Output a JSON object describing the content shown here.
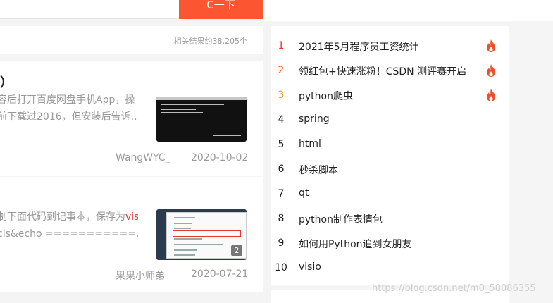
{
  "search": {
    "button_label": "C一下"
  },
  "results": {
    "count_text": "相关结果约38,205个",
    "items": [
      {
        "title": "）",
        "desc_line1": "容后打开百度网盘手机App，操",
        "desc_line2": "前下载过2016，但安装后告诉...",
        "author": "WangWYC_",
        "date": "2020-10-02"
      },
      {
        "desc_line1_pre": "制下面代码到记事本，保存为",
        "desc_line1_hl": "vis",
        "desc_line2": "cls&echo ===========...",
        "author": "果果小师弟",
        "date": "2020-07-21",
        "image_count": "2"
      }
    ]
  },
  "hot": {
    "items": [
      {
        "rank": "1",
        "title": "2021年5月程序员工资统计",
        "hot": true
      },
      {
        "rank": "2",
        "title": "领红包+快速涨粉！CSDN 测评赛开启",
        "hot": true
      },
      {
        "rank": "3",
        "title": "python爬虫",
        "hot": true
      },
      {
        "rank": "4",
        "title": "spring",
        "hot": false
      },
      {
        "rank": "5",
        "title": "html",
        "hot": false
      },
      {
        "rank": "6",
        "title": "秒杀脚本",
        "hot": false
      },
      {
        "rank": "7",
        "title": "qt",
        "hot": false
      },
      {
        "rank": "8",
        "title": "python制作表情包",
        "hot": false
      },
      {
        "rank": "9",
        "title": "如何用Python追到女朋友",
        "hot": false
      },
      {
        "rank": "10",
        "title": "visio",
        "hot": false
      }
    ]
  },
  "watermark": "https://blog.csdn.net/m0_58086355",
  "colors": {
    "accent": "#fc5531",
    "hot_fire": "#f24e2a"
  }
}
